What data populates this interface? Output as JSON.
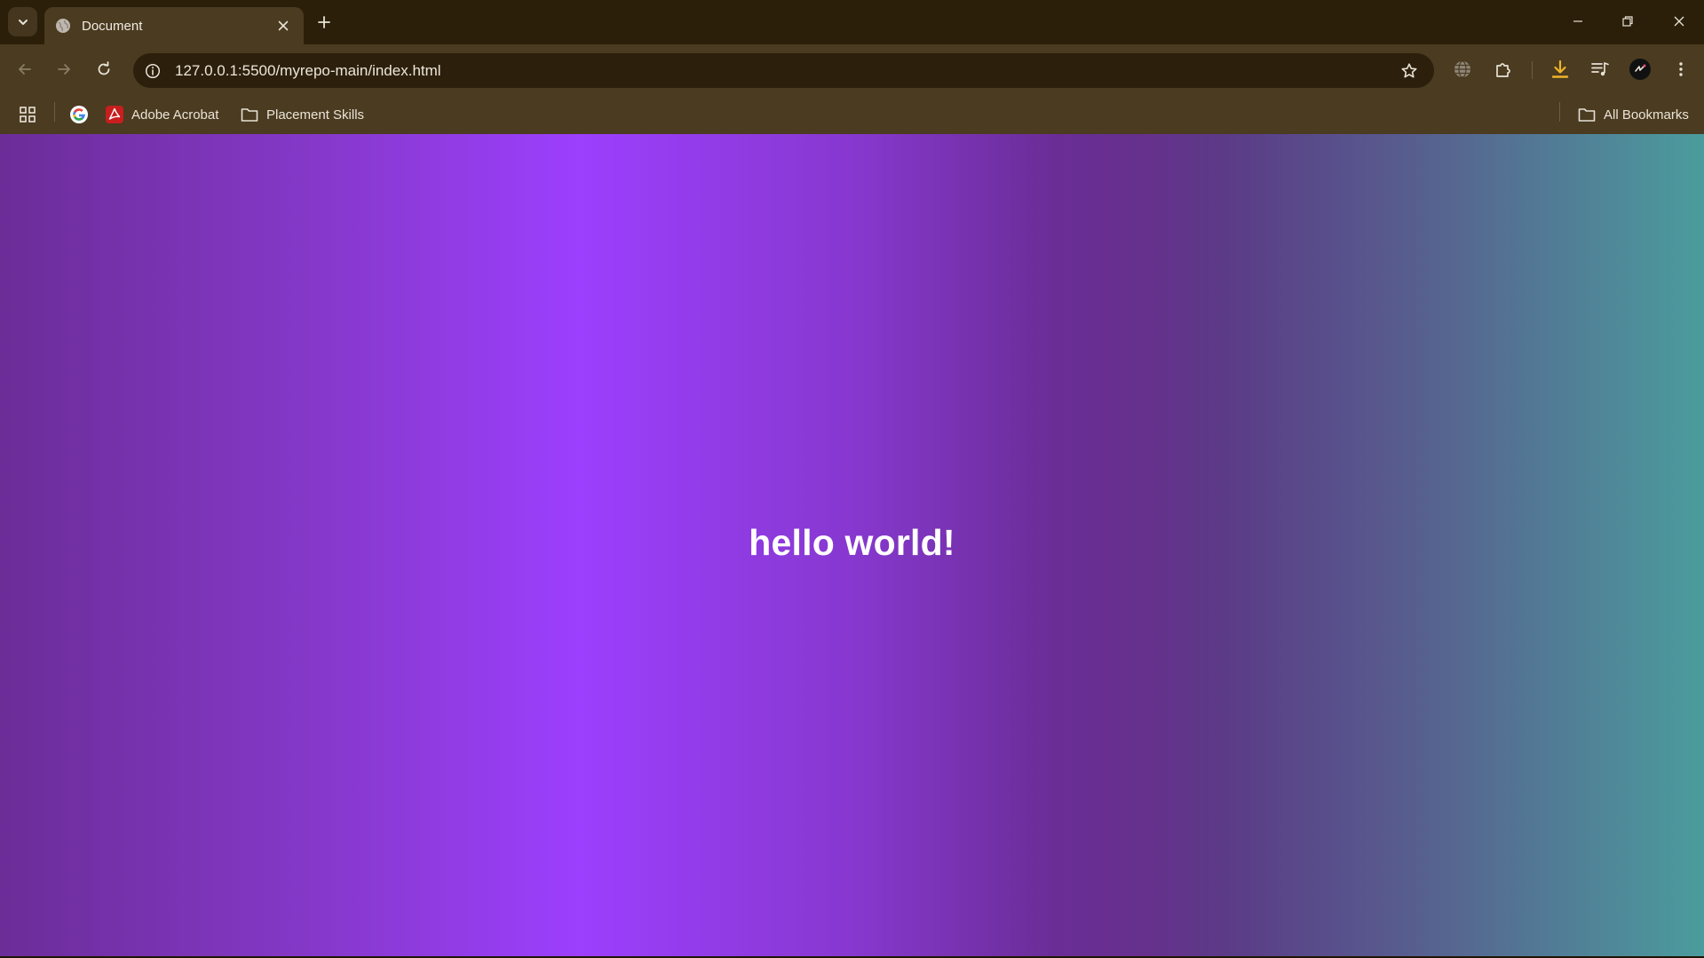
{
  "tab": {
    "title": "Document"
  },
  "toolbar": {
    "url": "127.0.0.1:5500/myrepo-main/index.html"
  },
  "bookmarks": {
    "items": [
      {
        "label": "Adobe Acrobat",
        "icon": "adobe-acrobat-icon"
      },
      {
        "label": "Placement Skills",
        "icon": "folder-icon"
      }
    ],
    "all_bookmarks_label": "All Bookmarks"
  },
  "page": {
    "heading": "hello world!"
  },
  "colors": {
    "tabstrip": "#2b1f0a",
    "toolbar": "#4a3b21",
    "omnibox": "#2c1f0c",
    "gradient_purple": "#9c3ffe",
    "gradient_teal": "#4b9c9d",
    "download_accent": "#f0b429"
  }
}
